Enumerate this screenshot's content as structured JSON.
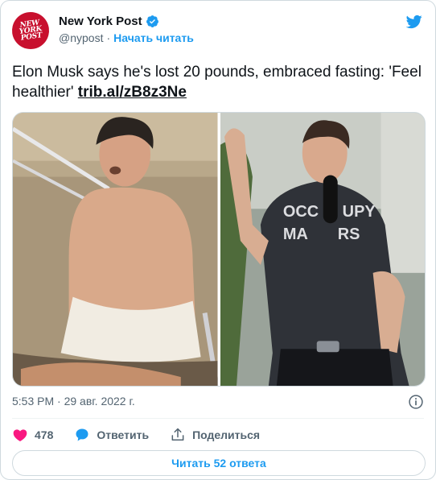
{
  "author": {
    "name": "New York Post",
    "handle": "@nypost",
    "separator": "·",
    "follow_label": "Начать читать",
    "avatar_text": [
      "NEW",
      "YORK",
      "POST"
    ],
    "verified": true
  },
  "tweet": {
    "text": "Elon Musk says he's lost 20 pounds, embraced fasting: 'Feel healthier'",
    "link": "trib.al/zB8z3Ne"
  },
  "media": {
    "left_shirt_text": [
      "OCC",
      "MA"
    ],
    "right_shirt_text": [
      "UPY",
      "RS"
    ]
  },
  "meta": {
    "timestamp": "5:53 PM · 29 авг. 2022 г."
  },
  "actions": {
    "like_count": "478",
    "reply_label": "Ответить",
    "share_label": "Поделиться"
  },
  "footer": {
    "read_replies_label": "Читать 52 ответа"
  },
  "colors": {
    "accent": "#1d9bf0",
    "like": "#f91880",
    "brand": "#c8102e"
  }
}
